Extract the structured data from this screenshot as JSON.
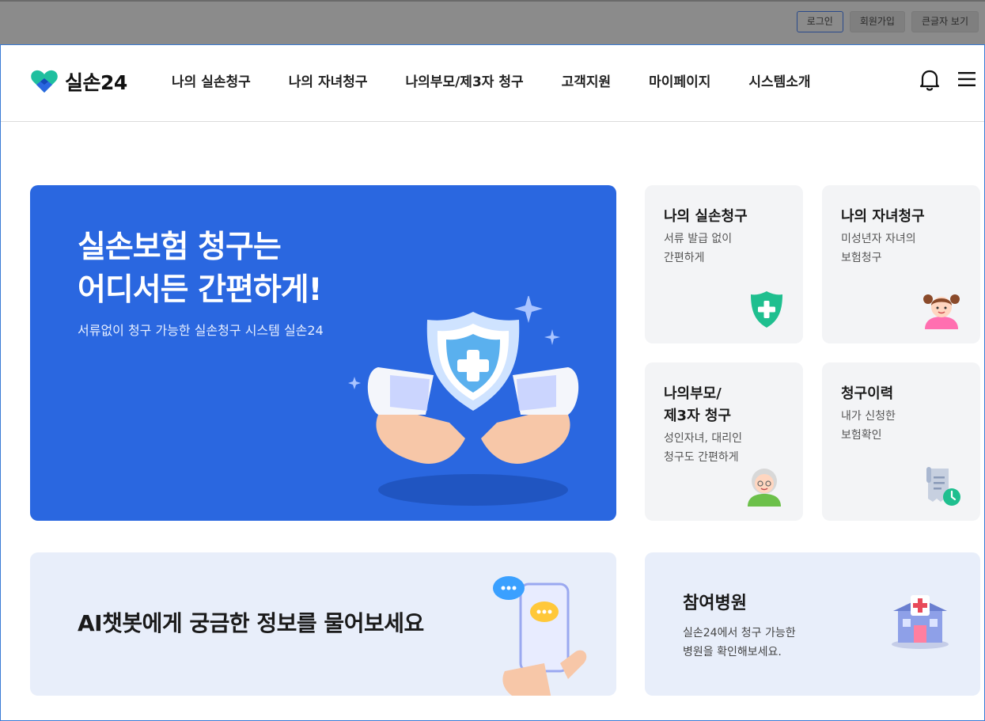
{
  "util_bar": {
    "login_label": "로그인",
    "signup_label": "회원가입",
    "large_text_label": "큰글자 보기"
  },
  "header": {
    "logo_text": "실손24",
    "nav": [
      {
        "label": "나의 실손청구"
      },
      {
        "label": "나의 자녀청구"
      },
      {
        "label": "나의부모/제3자 청구"
      },
      {
        "label": "고객지원"
      },
      {
        "label": "마이페이지"
      },
      {
        "label": "시스템소개"
      }
    ],
    "bell_icon": "bell-icon",
    "menu_icon": "hamburger-menu-icon"
  },
  "hero": {
    "title_line1": "실손보험 청구는",
    "title_line2": "어디서든 간편하게!",
    "subtitle": "서류없이 청구 가능한 실손청구 시스템 실손24",
    "bg_color": "#2a67e0"
  },
  "quick_cards": [
    {
      "title": "나의 실손청구",
      "desc": "서류 발급 없이\n간편하게",
      "icon": "shield-plus-icon"
    },
    {
      "title": "나의 자녀청구",
      "desc": "미성년자 자녀의\n보험청구",
      "icon": "child-avatar-icon"
    },
    {
      "title_line1": "나의부모/",
      "title_line2": "제3자 청구",
      "desc": "성인자녀, 대리인\n청구도 간편하게",
      "icon": "elder-avatar-icon"
    },
    {
      "title": "청구이력",
      "desc": "내가 신청한\n보험확인",
      "icon": "receipt-history-icon"
    }
  ],
  "ai_banner": {
    "text": "AI챗봇에게 궁금한 정보를 물어보세요"
  },
  "hospital_banner": {
    "title": "참여병원",
    "desc": "실손24에서 청구 가능한\n병원을 확인해보세요."
  },
  "colors": {
    "brand_blue": "#2a67e0",
    "brand_green": "#1fbf8f",
    "card_bg": "#f3f4f6",
    "banner_bg": "#e8eefa"
  }
}
